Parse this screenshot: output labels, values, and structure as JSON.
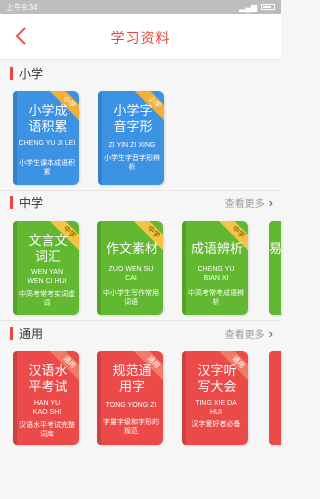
{
  "status": {
    "time": "上午9:34"
  },
  "nav": {
    "title": "学习资料",
    "back": "<"
  },
  "sections": {
    "primary": {
      "title": "小学",
      "books": [
        {
          "title": "小学成语积累",
          "pinyin": "CHENG YU JI LEI",
          "desc": "小学生课本成语积累",
          "tag": "小学"
        },
        {
          "title": "小学字音字形",
          "pinyin": "ZI YIN ZI XING",
          "desc": "小学生字音字形辨析",
          "tag": "小学"
        }
      ]
    },
    "middle": {
      "title": "中学",
      "more": "查看更多",
      "books": [
        {
          "title": "文言文词汇",
          "pinyin": "WEN YAN WEN CI HUI",
          "desc": "中高考常考实词虚词",
          "tag": "中学"
        },
        {
          "title": "作文素材",
          "pinyin": "ZUO WEN SU CAI",
          "desc": "中小学生写作常用词语",
          "tag": "中学"
        },
        {
          "title": "成语辨析",
          "pinyin": "CHENG YU BIAN XI",
          "desc": "中高考常考成语辨析",
          "tag": "中学"
        },
        {
          "edge_char": "易"
        }
      ]
    },
    "general": {
      "title": "通用",
      "more": "查看更多",
      "books": [
        {
          "title": "汉语水平考试",
          "pinyin": "HAN YU KAO SHI",
          "desc": "汉语水平考试完整词库",
          "tag": "通用"
        },
        {
          "title": "规范通用字",
          "pinyin": "TONG YONG ZI",
          "desc": "字量字级和字形的规范",
          "tag": "通用"
        },
        {
          "title": "汉字听写大会",
          "pinyin": "TING XIE DA HUI",
          "desc": "汉字爱好者必备",
          "tag": "通用"
        }
      ]
    }
  },
  "colors": {
    "accent": "#e8463c",
    "blue": "#3d93e3",
    "green": "#62b830",
    "red": "#ec4a49"
  }
}
